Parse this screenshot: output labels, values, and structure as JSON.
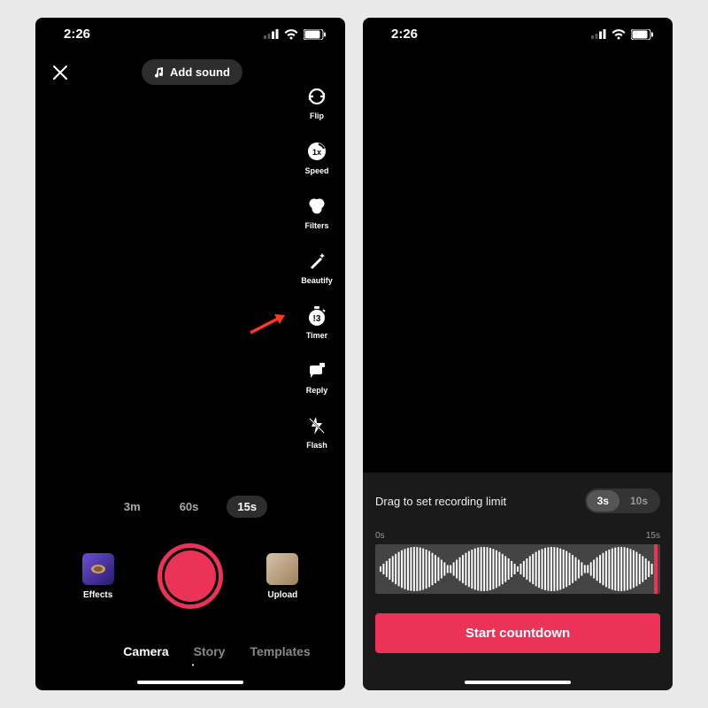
{
  "status": {
    "time": "2:26"
  },
  "left": {
    "add_sound": "Add sound",
    "tools": {
      "flip": "Flip",
      "speed": "Speed",
      "filters": "Filters",
      "beautify": "Beautify",
      "timer": "Timer",
      "reply": "Reply",
      "flash": "Flash"
    },
    "durations": {
      "d3m": "3m",
      "d60s": "60s",
      "d15s": "15s"
    },
    "effects": "Effects",
    "upload": "Upload",
    "modes": {
      "camera": "Camera",
      "story": "Story",
      "templates": "Templates"
    }
  },
  "right": {
    "drag_label": "Drag to set recording limit",
    "seg": {
      "s3": "3s",
      "s10": "10s"
    },
    "time_start": "0s",
    "time_end": "15s",
    "start": "Start countdown"
  }
}
